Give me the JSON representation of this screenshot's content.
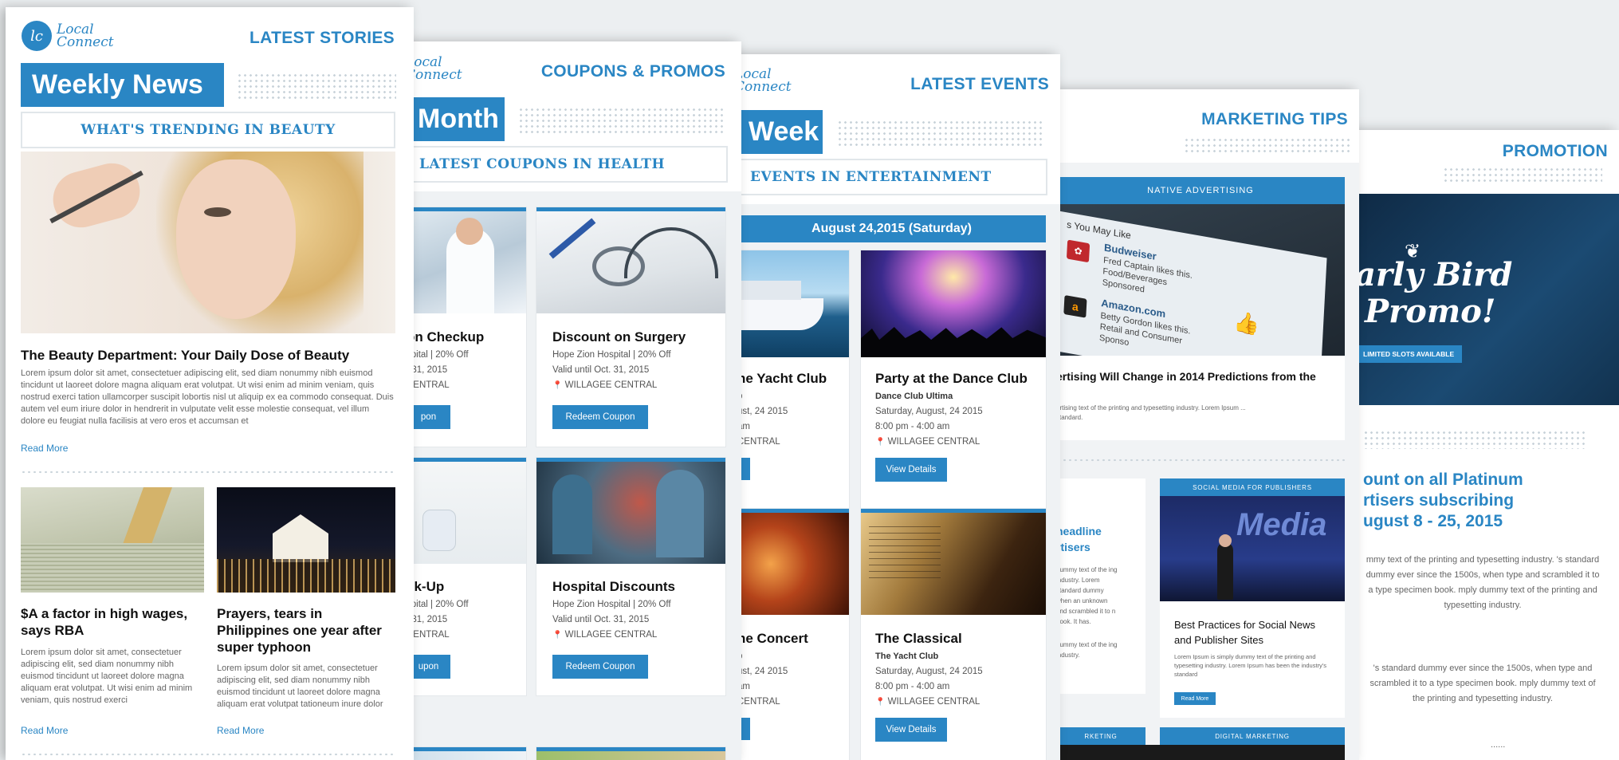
{
  "brand": {
    "mark": "lc",
    "name_line1": "Local",
    "name_line2": "Connect"
  },
  "card1": {
    "section": "LATEST STORIES",
    "title": "Weekly News",
    "subtitle": "WHAT'S TRENDING IN BEAUTY",
    "main_title": "The Beauty Department: Your Daily Dose of Beauty",
    "main_body": "Lorem ipsum dolor sit amet, consectetuer adipiscing elit, sed diam nonummy nibh euismod tincidunt ut laoreet dolore magna aliquam erat volutpat. Ut wisi enim ad minim veniam, quis nostrud exerci tation ullamcorper suscipit lobortis nisl ut aliquip ex ea commodo consequat. Duis autem vel eum iriure dolor in hendrerit in vulputate velit esse molestie consequat, vel illum dolore eu feugiat nulla facilisis at vero eros et accumsan et",
    "read_more": "Read More",
    "story1_title": "$A a factor in high wages, says RBA",
    "story1_body": "Lorem ipsum dolor sit amet, consectetuer adipiscing elit, sed diam nonummy nibh euismod tincidunt ut laoreet dolore magna aliquam erat volutpat. Ut wisi enim ad minim veniam, quis nostrud exerci",
    "story2_title": "Prayers, tears in Philippines one year after super typhoon",
    "story2_body": "Lorem ipsum dolor sit amet, consectetuer adipiscing elit, sed diam nonummy nibh euismod tincidunt ut laoreet dolore magna aliquam erat volutpat tationeum inure dolor"
  },
  "card2": {
    "section": "COUPONS & PROMOS",
    "title": "Month",
    "subtitle": "LATEST COUPONS IN HEALTH",
    "c1_title": "on Checkup",
    "c1_line1": "spital  |  20% Off",
    "c1_line2": ". 31, 2015",
    "c1_line3": "CENTRAL",
    "c1_btn": "pon",
    "c2_title": "Discount on Surgery",
    "c2_line1": "Hope Zion Hospital  |  20% Off",
    "c2_line2": "Valid until Oct. 31, 2015",
    "c2_line3": "WILLAGEE CENTRAL",
    "c2_btn": "Redeem Coupon",
    "c3_title": "ck-Up",
    "c3_line1": "spital  |  20% Off",
    "c3_line2": ". 31, 2015",
    "c3_line3": "CENTRAL",
    "c3_btn": "upon",
    "c4_title": "Hospital Discounts",
    "c4_line1": "Hope Zion Hospital  |  20% Off",
    "c4_line2": "Valid until Oct. 31, 2015",
    "c4_line3": "WILLAGEE CENTRAL",
    "c4_btn": "Redeem Coupon"
  },
  "card3": {
    "section": "LATEST EVENTS",
    "title": "Week",
    "subtitle": "EVENTS IN ENTERTAINMENT",
    "date_bar": "August 24,2015 (Saturday)",
    "e1_title": "ne Yacht Club",
    "e1_line1": "b",
    "e1_line2": "ust, 24 2015",
    "e1_line3": "am",
    "e1_line4": "CENTRAL",
    "e2_title": "Party at the Dance Club",
    "e2_venue": "Dance Club Ultima",
    "e2_date": "Saturday, August, 24 2015",
    "e2_time": "8:00 pm - 4:00 am",
    "e2_loc": "WILLAGEE CENTRAL",
    "e2_btn": "View Details",
    "e3_title": "ne Concert",
    "e3_line1": "b",
    "e3_line2": "ust, 24 2015",
    "e3_line3": "am",
    "e3_line4": "CENTRAL",
    "e4_title": "The Classical",
    "e4_venue": "The Yacht Club",
    "e4_date": "Saturday, August, 24 2015",
    "e4_time": "8:00 pm - 4:00 am",
    "e4_loc": "WILLAGEE CENTRAL",
    "e4_btn": "View Details"
  },
  "card4": {
    "section": "MARKETING TIPS",
    "native_label": "NATIVE ADVERTISING",
    "native_title": "ertising Will Change in 2014 Predictions from the",
    "native_body": "ertising text of the printing and typesetting industry. Lorem Ipsum ... standard.",
    "phone_lines": [
      "s You May Like",
      "Budweiser",
      "Fred Captain likes this.",
      "Food/Beverages",
      "Sponsored",
      "Amazon.com",
      "Betty Gordon likes this.",
      "Retail and Consumer",
      "Sponso"
    ],
    "left_title": "headline rtisers",
    "left_body": "dummy text of the ing industry. Lorem standard dummy when an unknown and scrambled it to n book. It has.",
    "left_body2": "dummy text of the ing industry.",
    "social_label": "SOCIAL MEDIA FOR PUBLISHERS",
    "social_screen": "Media",
    "social_title": "Best Practices for Social News and Publisher Sites",
    "social_body": "Lorem Ipsum is simply dummy text of the printing and typesetting industry. Lorem Ipsum has been the industry's standard",
    "social_btn": "Read More",
    "bottom_left_label": "RKETING",
    "bottom_right_label": "DIGITAL MARKETING"
  },
  "card5": {
    "section": "PROMOTION",
    "promo_line1": "arly Bird",
    "promo_line2": "Promo!",
    "promo_badge": "LIMITED SLOTS AVAILABLE",
    "headline": "ount on all Platinum rtisers subscribing ugust 8 - 25, 2015",
    "body1": "mmy text of the printing and typesetting industry. 's standard dummy ever since the 1500s, when type and scrambled it to a type specimen book. mply dummy text of the printing and typesetting industry.",
    "body2": "'s standard dummy ever since the 1500s, when type and scrambled it to a type specimen book. mply dummy text of the printing and typesetting industry.",
    "ellipsis": "......"
  },
  "colors": {
    "accent": "#2a86c4",
    "background": "#eceff1"
  }
}
